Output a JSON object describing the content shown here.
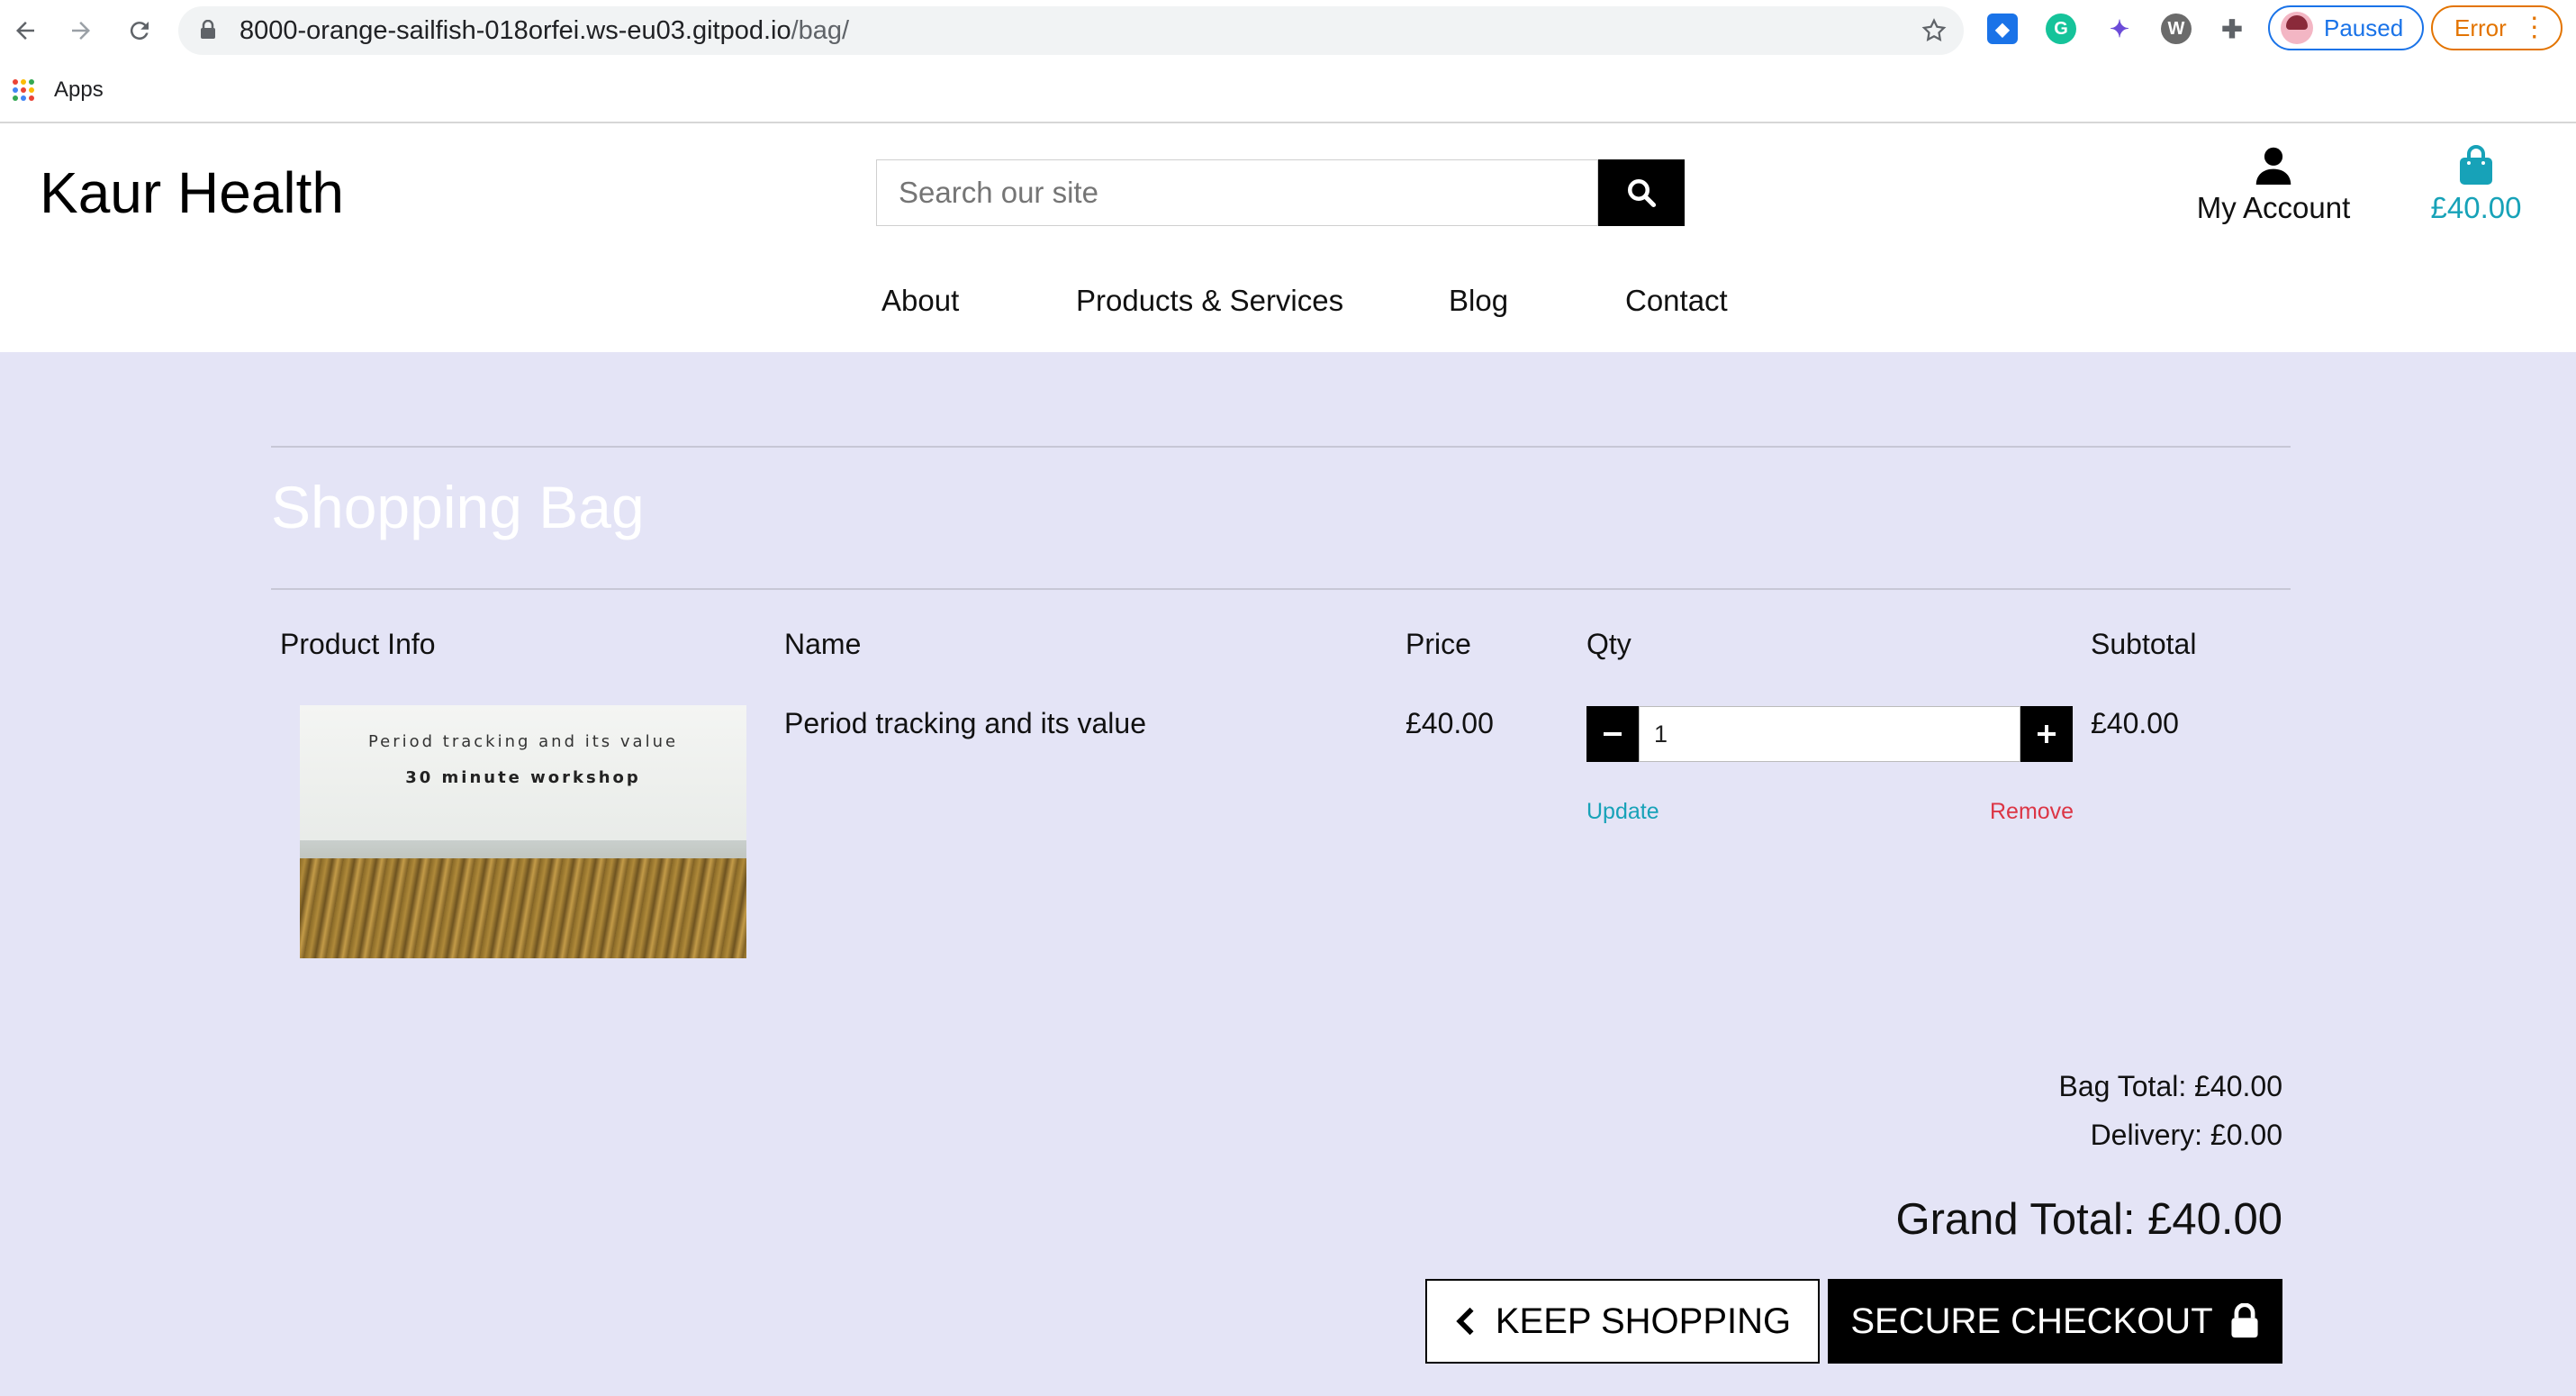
{
  "browser": {
    "url_host": "8000-orange-sailfish-018orfei.ws-eu03.gitpod.io",
    "url_path": "/bag/",
    "profile_status": "Paused",
    "error_label": "Error",
    "bookmark_apps": "Apps"
  },
  "header": {
    "brand": "Kaur Health",
    "search_placeholder": "Search our site",
    "account_label": "My Account",
    "bag_total": "£40.00",
    "accent_color": "#17a2b8"
  },
  "nav": {
    "items": [
      "About",
      "Products & Services",
      "Blog",
      "Contact"
    ]
  },
  "bag": {
    "title": "Shopping Bag",
    "columns": [
      "Product Info",
      "Name",
      "Price",
      "Qty",
      "Subtotal"
    ],
    "items": [
      {
        "image_text_1": "Period tracking and its value",
        "image_text_2": "30 minute workshop",
        "name": "Period tracking and its value",
        "price": "£40.00",
        "qty": "1",
        "subtotal": "£40.00",
        "update_label": "Update",
        "remove_label": "Remove"
      }
    ],
    "bag_total": "Bag Total: £40.00",
    "delivery": "Delivery: £0.00",
    "grand_total": "Grand Total: £40.00",
    "keep_shopping_label": "KEEP SHOPPING",
    "secure_checkout_label": "SECURE CHECKOUT",
    "remove_color": "#dc3545",
    "page_background": "#e4e4f6"
  }
}
